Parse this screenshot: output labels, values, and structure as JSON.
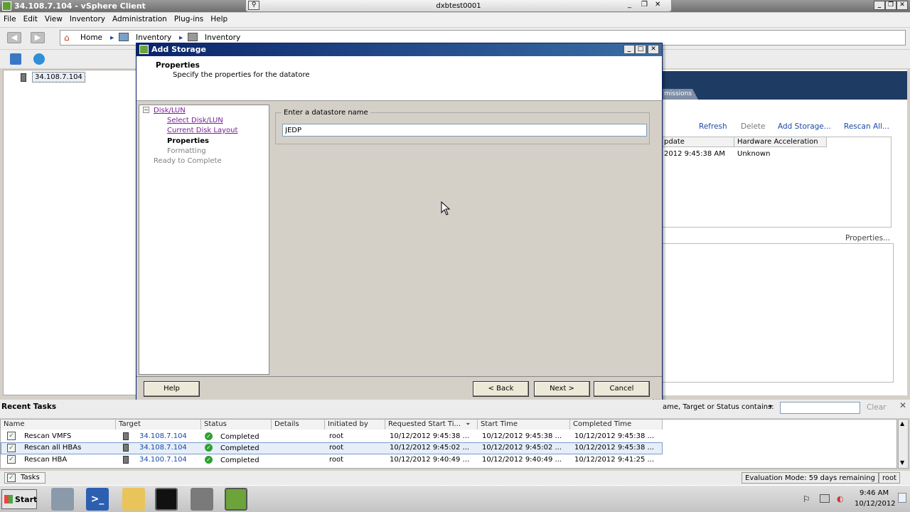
{
  "window": {
    "title": "34.108.7.104 - vSphere Client",
    "rdp_host": "dxbtest0001"
  },
  "menu": [
    "File",
    "Edit",
    "View",
    "Inventory",
    "Administration",
    "Plug-ins",
    "Help"
  ],
  "nav": {
    "home": "Home",
    "crumb1": "Inventory",
    "crumb2": "Inventory"
  },
  "tree": {
    "host": "34.108.7.104"
  },
  "background": {
    "tab_fragment": "missions",
    "links": {
      "refresh": "Refresh",
      "delete": "Delete",
      "add_storage": "Add Storage...",
      "rescan_all": "Rescan All..."
    },
    "table": {
      "headers": [
        "pdate",
        "Hardware Acceleration"
      ],
      "row": [
        "2012 9:45:38 AM",
        "Unknown"
      ]
    },
    "properties_link": "Properties..."
  },
  "dialog": {
    "title": "Add Storage",
    "header_title": "Properties",
    "header_subtitle": "Specify the properties for the datatore",
    "steps": {
      "disk_lun": "Disk/LUN",
      "select_disk": "Select Disk/LUN",
      "current_layout": "Current Disk Layout",
      "properties": "Properties",
      "formatting": "Formatting",
      "ready": "Ready to Complete"
    },
    "group_label": "Enter a datastore name",
    "datastore_name": "JEDP",
    "buttons": {
      "help": "Help",
      "back": "< Back",
      "next": "Next >",
      "cancel": "Cancel"
    }
  },
  "recent_tasks": {
    "title": "Recent Tasks",
    "filter_label": "ame, Target or Status contains:",
    "clear": "Clear",
    "columns": [
      "Name",
      "Target",
      "Status",
      "Details",
      "Initiated by",
      "Requested Start Ti...",
      "Start Time",
      "Completed Time"
    ],
    "rows": [
      {
        "name": "Rescan VMFS",
        "target": "34.108.7.104",
        "status": "Completed",
        "initiated": "root",
        "requested": "10/12/2012 9:45:38 ...",
        "start": "10/12/2012 9:45:38 ...",
        "completed": "10/12/2012 9:45:38 ..."
      },
      {
        "name": "Rescan all HBAs",
        "target": "34.108.7.104",
        "status": "Completed",
        "initiated": "root",
        "requested": "10/12/2012 9:45:02 ...",
        "start": "10/12/2012 9:45:02 ...",
        "completed": "10/12/2012 9:45:38 ..."
      },
      {
        "name": "Rescan HBA",
        "target": "34.100.7.104",
        "status": "Completed",
        "initiated": "root",
        "requested": "10/12/2012 9:40:49 ...",
        "start": "10/12/2012 9:40:49 ...",
        "completed": "10/12/2012 9:41:25 ..."
      }
    ]
  },
  "statusbar": {
    "tasks": "Tasks",
    "evaluation": "Evaluation Mode: 59 days remaining",
    "user": "root"
  },
  "taskbar": {
    "start": "Start",
    "time": "9:46 AM",
    "date": "10/12/2012"
  }
}
